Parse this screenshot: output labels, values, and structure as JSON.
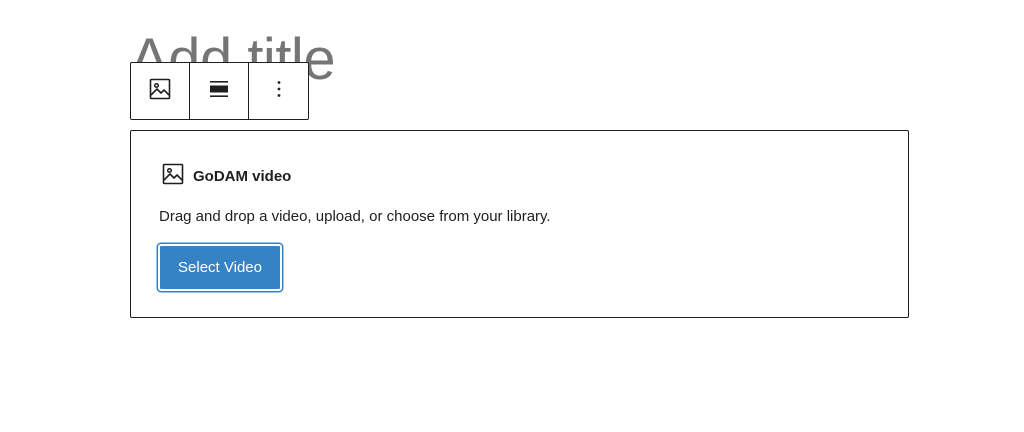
{
  "editor": {
    "title_placeholder": "Add title"
  },
  "toolbar": {
    "buttons": [
      {
        "icon": "image-icon"
      },
      {
        "icon": "align-wide-icon"
      },
      {
        "icon": "more-vertical-icon"
      }
    ]
  },
  "block": {
    "label": "GoDAM video",
    "icon": "image-icon",
    "instructions": "Drag and drop a video, upload, or choose from your library.",
    "select_button_label": "Select Video"
  },
  "colors": {
    "accent": "#3582c4",
    "border": "#1e1e1e",
    "placeholder_text": "#757575"
  }
}
